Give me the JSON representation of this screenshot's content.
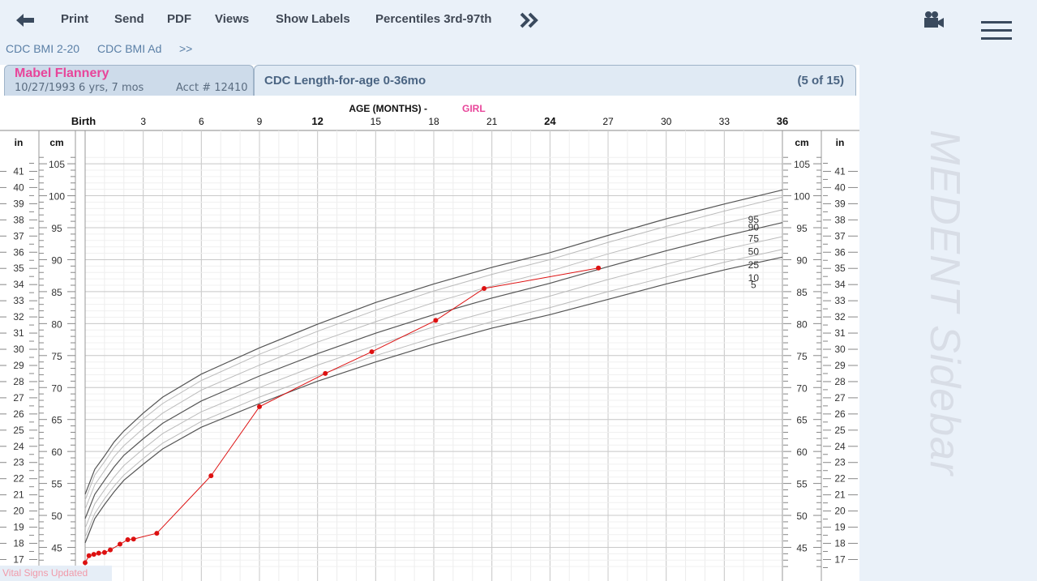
{
  "toolbar": {
    "print": "Print",
    "send": "Send",
    "pdf": "PDF",
    "views": "Views",
    "show_labels": "Show Labels",
    "percentiles": "Percentiles 3rd-97th"
  },
  "subtabs": {
    "tab1": "CDC BMI 2-20",
    "tab2": "CDC BMI Ad",
    "more": ">>"
  },
  "patient": {
    "name": "Mabel Flannery",
    "dob_age": "10/27/1993   6 yrs, 7 mos",
    "acct": "Acct # 12410"
  },
  "chart_tab": {
    "title": "CDC Length-for-age 0-36mo",
    "count": "(5 of 15)"
  },
  "sidebar": {
    "label": "MEDENT Sidebar"
  },
  "status": {
    "text": "Vital Signs Updated"
  },
  "icons": {
    "back": "left-arrow-icon",
    "more": "double-chevron-right-icon",
    "camera": "video-camera-icon",
    "menu": "hamburger-menu-icon"
  },
  "colors": {
    "patient_line": "#dd1111",
    "percentile_dark": "#555555",
    "percentile_light": "#bbbbbb",
    "girl_label": "#e8459a"
  },
  "chart_data": {
    "type": "line",
    "title": "AGE (MONTHS)",
    "title_sep": "-",
    "sex": "GIRL",
    "xlabel": "AGE (MONTHS)",
    "x_ticks": [
      "Birth",
      "3",
      "6",
      "9",
      "12",
      "15",
      "18",
      "21",
      "24",
      "27",
      "30",
      "33",
      "36"
    ],
    "x_bold_ticks": [
      "12",
      "24",
      "36"
    ],
    "xlim": [
      0,
      36
    ],
    "ylim_cm": [
      42,
      106
    ],
    "cm_ticks": [
      45,
      50,
      55,
      60,
      65,
      70,
      75,
      80,
      85,
      90,
      95,
      100,
      105
    ],
    "in_ticks": [
      17,
      18,
      19,
      20,
      21,
      22,
      23,
      24,
      25,
      26,
      27,
      28,
      29,
      30,
      31,
      32,
      33,
      34,
      35,
      36,
      37,
      38,
      39,
      40,
      41
    ],
    "unit_labels": {
      "cm": "cm",
      "in": "in"
    },
    "percentile_x": [
      0,
      0.5,
      1,
      1.5,
      2,
      3,
      4,
      6,
      9,
      12,
      15,
      18,
      21,
      24,
      27,
      30,
      33,
      36
    ],
    "percentiles": [
      {
        "name": "95",
        "values": [
          53.3,
          57.2,
          59.3,
          61.5,
          63.2,
          66.0,
          68.5,
          72.1,
          76.2,
          79.9,
          83.3,
          86.2,
          88.8,
          91.1,
          93.8,
          96.4,
          98.7,
          100.9
        ]
      },
      {
        "name": "90",
        "values": [
          52.4,
          56.3,
          58.4,
          60.6,
          62.3,
          65.1,
          67.5,
          71.1,
          75.2,
          78.8,
          82.1,
          85.1,
          87.7,
          90.0,
          92.7,
          95.2,
          97.6,
          99.8
        ]
      },
      {
        "name": "75",
        "values": [
          51.0,
          54.8,
          57.0,
          59.2,
          60.9,
          63.6,
          66.0,
          69.6,
          73.5,
          77.1,
          80.3,
          83.3,
          85.9,
          88.2,
          90.9,
          93.4,
          95.7,
          97.8
        ]
      },
      {
        "name": "50",
        "values": [
          49.5,
          53.3,
          55.5,
          57.6,
          59.4,
          62.0,
          64.4,
          67.9,
          71.8,
          75.3,
          78.5,
          81.4,
          84.0,
          86.3,
          88.9,
          91.4,
          93.7,
          95.8
        ]
      },
      {
        "name": "25",
        "values": [
          48.0,
          51.8,
          54.0,
          56.0,
          57.8,
          60.4,
          62.8,
          66.2,
          70.0,
          73.5,
          76.6,
          79.5,
          82.0,
          84.3,
          86.9,
          89.3,
          91.6,
          93.6
        ]
      },
      {
        "name": "10",
        "values": [
          46.6,
          50.3,
          52.6,
          54.6,
          56.3,
          58.9,
          61.3,
          64.7,
          68.5,
          71.9,
          75.0,
          77.8,
          80.3,
          82.5,
          85.0,
          87.3,
          89.6,
          91.6
        ]
      },
      {
        "name": "5",
        "values": [
          45.7,
          49.5,
          51.7,
          53.7,
          55.5,
          58.0,
          60.4,
          63.8,
          67.5,
          71.0,
          74.0,
          76.8,
          79.3,
          81.4,
          83.8,
          86.2,
          88.4,
          90.4
        ]
      }
    ],
    "patient_points": {
      "x": [
        0,
        0.2,
        0.45,
        0.7,
        1.0,
        1.3,
        1.8,
        2.2,
        2.5,
        3.7,
        6.5,
        9.0,
        12.4,
        14.8,
        18.1,
        20.6,
        26.5
      ],
      "y": [
        42.6,
        43.7,
        43.9,
        44.1,
        44.2,
        44.6,
        45.5,
        46.2,
        46.3,
        47.2,
        56.2,
        67.0,
        72.2,
        75.6,
        80.5,
        85.5,
        88.7
      ]
    }
  }
}
